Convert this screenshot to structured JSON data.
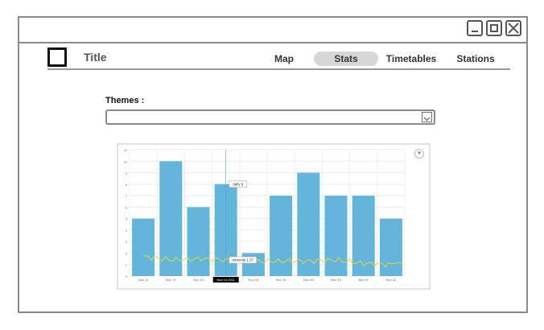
{
  "window": {
    "controls": [
      "minimize-icon",
      "maximize-icon",
      "close-icon"
    ]
  },
  "header": {
    "title": "Title",
    "nav": {
      "map": "Map",
      "stats": "Stats",
      "timetables": "Timetables",
      "stations": "Stations"
    },
    "active_tab": "Stats"
  },
  "filters": {
    "themes_label": "Themes :",
    "themes_value": ""
  },
  "chart_data": {
    "type": "bar",
    "title": "",
    "xlabel": "",
    "ylabel": "",
    "ylim": [
      0,
      11
    ],
    "yticks": [
      "0",
      "1",
      "2",
      "3",
      "4",
      "5",
      "6",
      "7",
      "8",
      "9",
      "10",
      "11"
    ],
    "categories": [
      "Nov 11",
      "Nov 12",
      "Nov 13",
      "Nov 14 2011",
      "Nov 15",
      "Nov 16",
      "Nov 18",
      "Nov 19",
      "Nov 21",
      "Nov 22"
    ],
    "highlighted_category_index": 3,
    "series": [
      {
        "values": [
          5,
          10,
          6,
          8,
          2,
          7,
          9,
          7,
          7,
          5
        ],
        "color": "#64b5dc"
      },
      {
        "values": [
          1.7,
          1.4,
          1.5,
          1.4,
          1.3,
          1.3,
          1.3,
          1.4,
          1.1,
          1.0
        ],
        "color": "#e3d93a"
      }
    ],
    "tooltips": [
      "dally 6",
      "transvity 1.57"
    ],
    "grid": true
  }
}
